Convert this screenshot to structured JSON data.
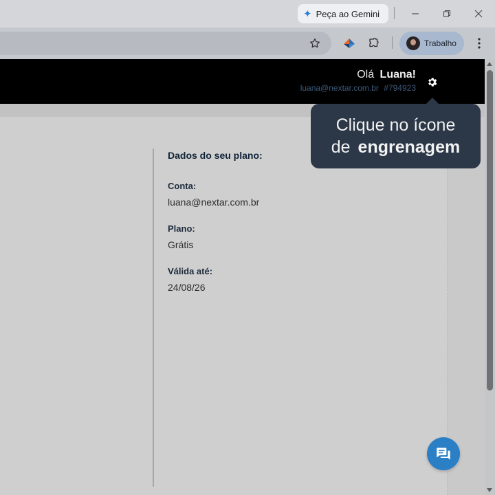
{
  "browser": {
    "gemini_button": {
      "label": "Peça ao Gemini",
      "icon": "gemini-sparkle-icon"
    },
    "window_controls": {
      "minimize_icon": "minimize-icon",
      "maximize_icon": "maximize-icon",
      "close_icon": "close-icon"
    },
    "toolbar": {
      "bookmark_icon": "star-icon",
      "extensions": [
        "nextar-extension-icon",
        "puzzle-extensions-icon"
      ],
      "profile": {
        "label": "Trabalho"
      },
      "menu_icon": "more-vert-icon"
    }
  },
  "header": {
    "greeting_prefix": "Olá",
    "user_name": "Luana!",
    "email": "luana@nextar.com.br",
    "account_id": "#794923",
    "settings_icon": "gear-icon"
  },
  "plan": {
    "title": "Dados do seu plano:",
    "fields": [
      {
        "label": "Conta:",
        "value": "luana@nextar.com.br"
      },
      {
        "label": "Plano:",
        "value": "Grátis"
      },
      {
        "label": "Válida até:",
        "value": "24/08/26"
      }
    ]
  },
  "tooltip": {
    "line1": "Clique no ícone",
    "line2_prefix": "de",
    "line2_bold": "engrenagem"
  },
  "chat": {
    "icon": "chat-bubbles-icon"
  },
  "colors": {
    "header_bg": "#000000",
    "tooltip_bg": "#2c3847",
    "chat_fab": "#2b7fc4",
    "profile_pill": "#a8b8cf"
  }
}
